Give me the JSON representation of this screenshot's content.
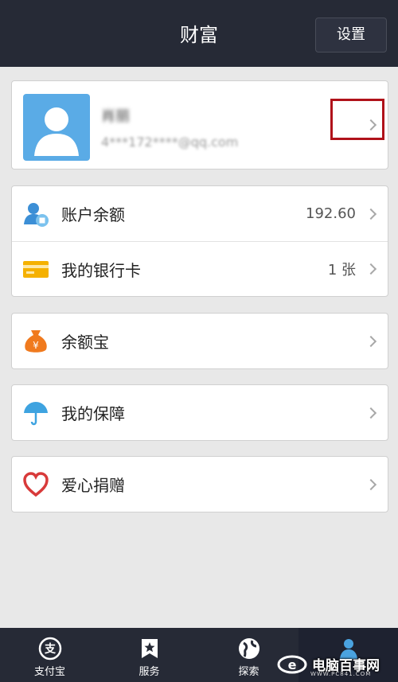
{
  "header": {
    "title": "财富",
    "settings_label": "设置"
  },
  "profile": {
    "name": "肖丽",
    "email": "4***172****@qq.com"
  },
  "account": [
    {
      "label": "账户余额",
      "value": "192.60",
      "icon": "account-balance-icon"
    },
    {
      "label": "我的银行卡",
      "value": "1 张",
      "icon": "bank-card-icon"
    }
  ],
  "yuebao": {
    "label": "余额宝",
    "icon": "money-bag-icon"
  },
  "insurance": {
    "label": "我的保障",
    "icon": "umbrella-icon"
  },
  "charity": {
    "label": "爱心捐赠",
    "icon": "heart-icon"
  },
  "tabs": [
    {
      "label": "支付宝",
      "icon": "alipay-icon"
    },
    {
      "label": "服务",
      "icon": "star-icon"
    },
    {
      "label": "探索",
      "icon": "globe-icon"
    },
    {
      "label": "",
      "icon": "wealth-icon"
    }
  ],
  "watermark": {
    "text": "电脑百事网",
    "sub": "WWW.PC841.COM"
  },
  "colors": {
    "header_bg": "#262a36",
    "accent_blue": "#5aabe6",
    "highlight_red": "#b0121a",
    "yuebao_orange": "#f07a1e",
    "card_yellow": "#f5b100"
  }
}
